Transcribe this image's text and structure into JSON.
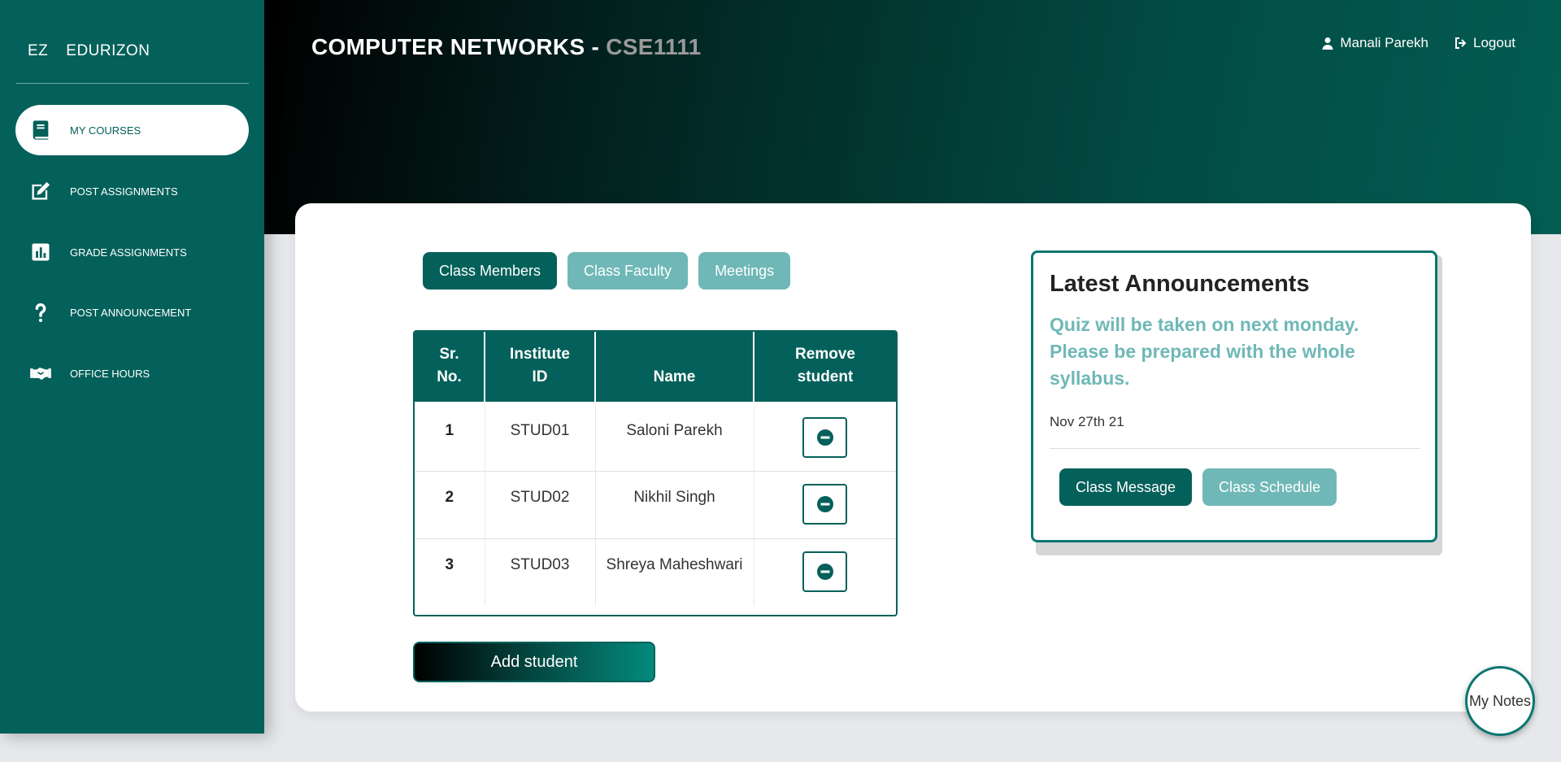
{
  "brand": {
    "short": "EZ",
    "name": "EDURIZON"
  },
  "sidebar": {
    "items": [
      {
        "label": "MY COURSES",
        "icon": "book-icon",
        "active": true
      },
      {
        "label": "POST ASSIGNMENTS",
        "icon": "edit-icon"
      },
      {
        "label": "GRADE ASSIGNMENTS",
        "icon": "bar-chart-icon"
      },
      {
        "label": "POST ANNOUNCEMENT",
        "icon": "question-icon"
      },
      {
        "label": "OFFICE HOURS",
        "icon": "handshake-icon"
      }
    ]
  },
  "header": {
    "course_name": "COMPUTER NETWORKS - ",
    "course_code": "CSE1111",
    "user_name": "Manali Parekh",
    "logout_label": "Logout"
  },
  "tabs": [
    "Class Members",
    "Class Faculty",
    "Meetings"
  ],
  "table": {
    "headers": [
      "Sr. No.",
      "Institute ID",
      "Name",
      "Remove student"
    ],
    "rows": [
      {
        "sr": "1",
        "id": "STUD01",
        "name": "Saloni Parekh"
      },
      {
        "sr": "2",
        "id": "STUD02",
        "name": "Nikhil Singh"
      },
      {
        "sr": "3",
        "id": "STUD03",
        "name": "Shreya Maheshwari"
      }
    ]
  },
  "add_student_label": "Add student",
  "announcements": {
    "title": "Latest Announcements",
    "message": "Quiz will be taken on next monday. Please be prepared with the whole syllabus.",
    "date": "Nov 27th 21",
    "buttons": [
      "Class Message",
      "Class Schedule"
    ]
  },
  "notes_label": "My Notes",
  "colors": {
    "primary": "#04605a",
    "accent": "#6fb8b7"
  }
}
